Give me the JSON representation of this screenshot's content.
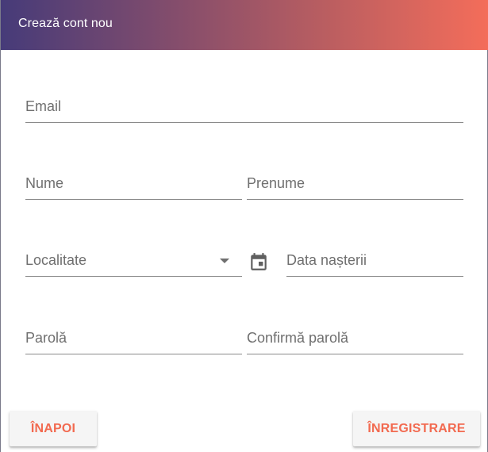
{
  "dialog": {
    "title": "Crează cont nou",
    "header_gradient": [
      "#463b79",
      "#f46d5a"
    ]
  },
  "form": {
    "email": {
      "label": "Email"
    },
    "nume": {
      "label": "Nume"
    },
    "prenume": {
      "label": "Prenume"
    },
    "localitate": {
      "label": "Localitate",
      "icon": "chevron-down-icon"
    },
    "data_nasterii": {
      "label": "Data nașterii",
      "icon": "calendar-icon"
    },
    "parola": {
      "label": "Parolă"
    },
    "confirma_parola": {
      "label": "Confirmă parolă"
    }
  },
  "actions": {
    "back_label": "ÎNAPOI",
    "register_label": "ÎNREGISTRARE",
    "accent_color": "#f26a50"
  }
}
